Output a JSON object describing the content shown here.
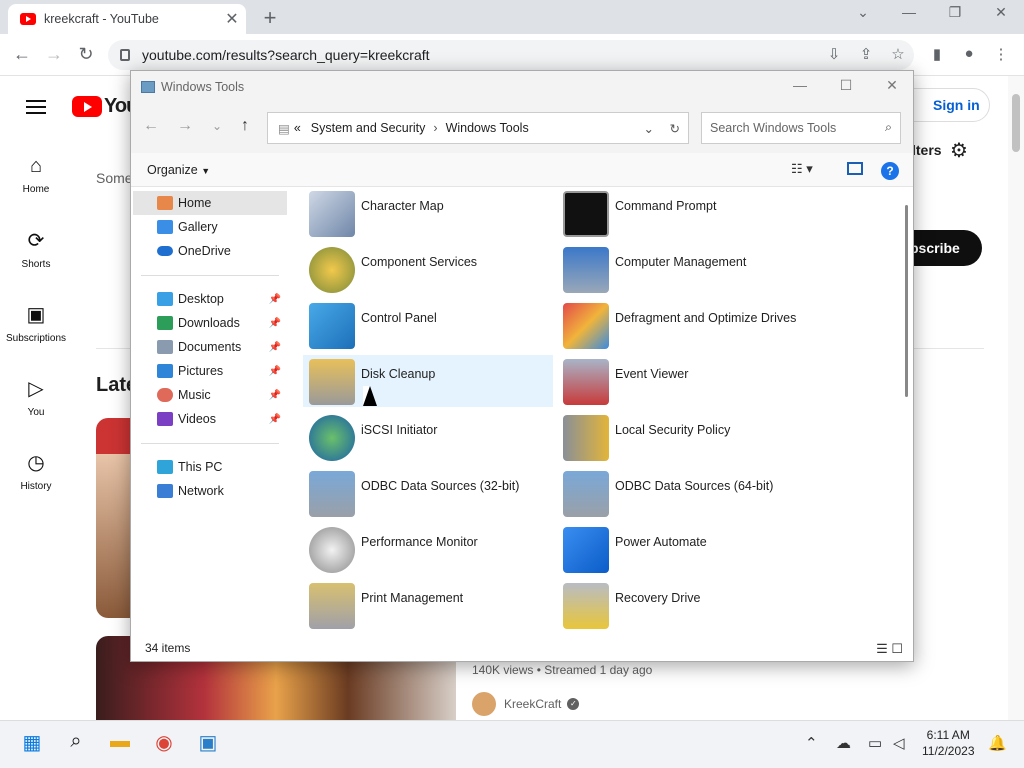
{
  "browser": {
    "tab_title": "kreekcraft - YouTube",
    "url": "youtube.com/results?search_query=kreekcraft"
  },
  "youtube": {
    "logo_text": "You",
    "nav": [
      "Home",
      "Shorts",
      "Subscriptions",
      "You",
      "History"
    ],
    "signin": "Sign in",
    "filters": "lters",
    "subscribe": "bscribe",
    "some_text": "Some",
    "latest_text": "Late",
    "video_meta": "140K views • Streamed 1 day ago",
    "channel": "KreekCraft"
  },
  "explorer": {
    "title": "Windows Tools",
    "breadcrumb": [
      "System and Security",
      "Windows Tools"
    ],
    "search_placeholder": "Search Windows Tools",
    "organize": "Organize",
    "tree": {
      "home": "Home",
      "gallery": "Gallery",
      "onedrive": "OneDrive",
      "desktop": "Desktop",
      "downloads": "Downloads",
      "documents": "Documents",
      "pictures": "Pictures",
      "music": "Music",
      "videos": "Videos",
      "thispc": "This PC",
      "network": "Network"
    },
    "items": [
      "Character Map",
      "Command Prompt",
      "Component Services",
      "Computer Management",
      "Control Panel",
      "Defragment and Optimize Drives",
      "Disk Cleanup",
      "Event Viewer",
      "iSCSI Initiator",
      "Local Security Policy",
      "ODBC Data Sources (32-bit)",
      "ODBC Data Sources (64-bit)",
      "Performance Monitor",
      "Power Automate",
      "Print Management",
      "Recovery Drive"
    ],
    "status": "34 items"
  },
  "taskbar": {
    "time": "6:11 AM",
    "date": "11/2/2023"
  },
  "colors": {
    "youtube_red": "#ff0000",
    "selection": "#e5f3ff",
    "accent": "#1a73e8"
  }
}
